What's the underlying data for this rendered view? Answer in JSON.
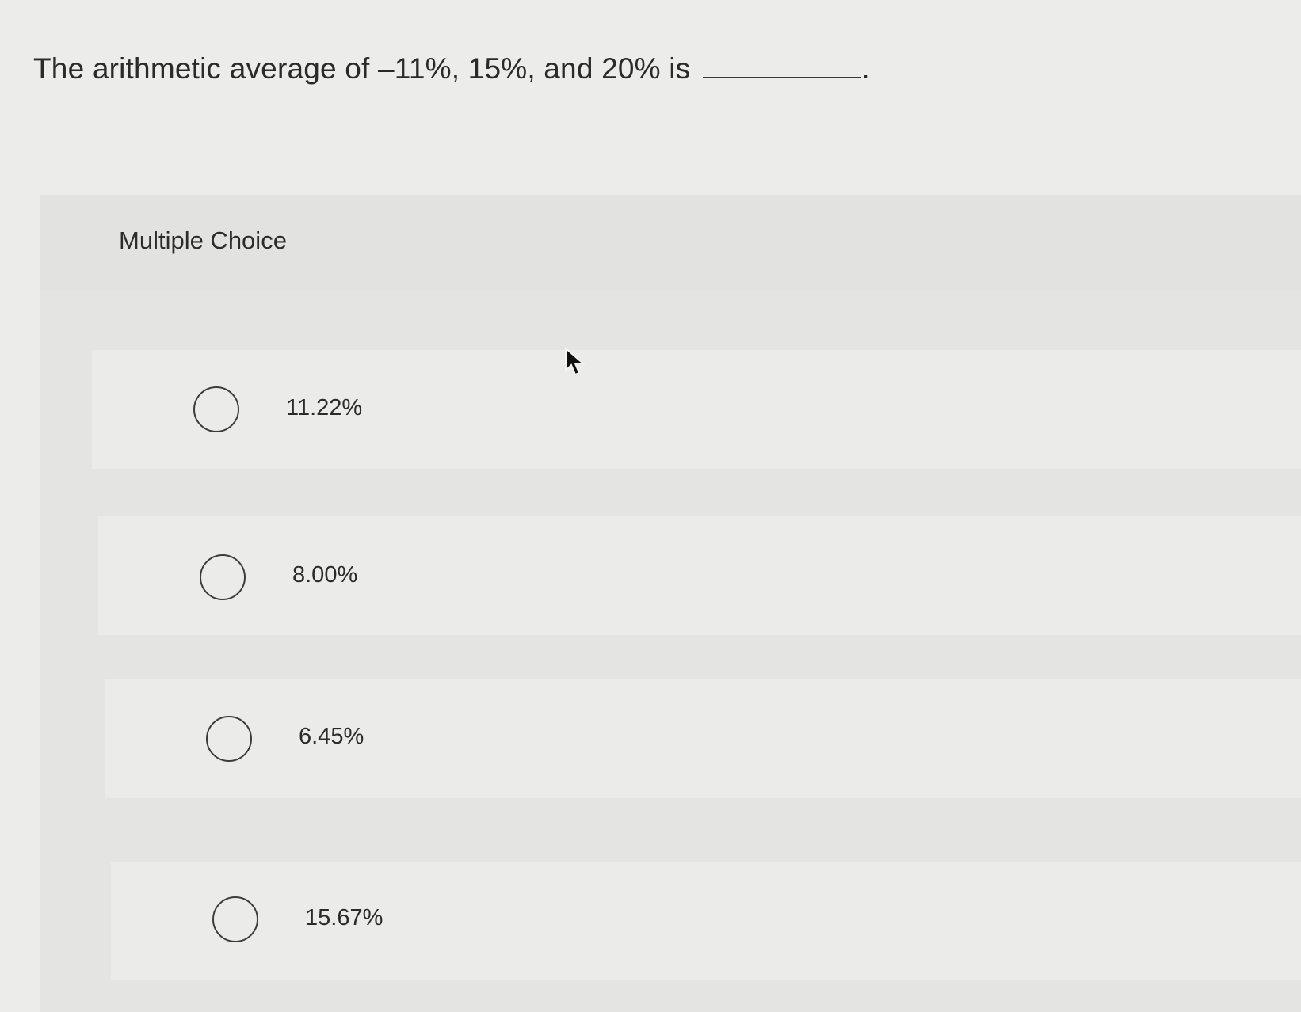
{
  "question": {
    "text": "The arithmetic average of –11%, 15%, and 20% is",
    "blank_suffix": "."
  },
  "multiple_choice": {
    "label": "Multiple Choice",
    "options": [
      {
        "label": "11.22%"
      },
      {
        "label": "8.00%"
      },
      {
        "label": "6.45%"
      },
      {
        "label": "15.67%"
      }
    ]
  },
  "icons": {
    "radio": "radio-unselected-icon",
    "cursor": "mouse-pointer-icon"
  },
  "colors": {
    "background": "#ececea",
    "panel": "#e4e4e2",
    "text": "#2b2b2b"
  }
}
